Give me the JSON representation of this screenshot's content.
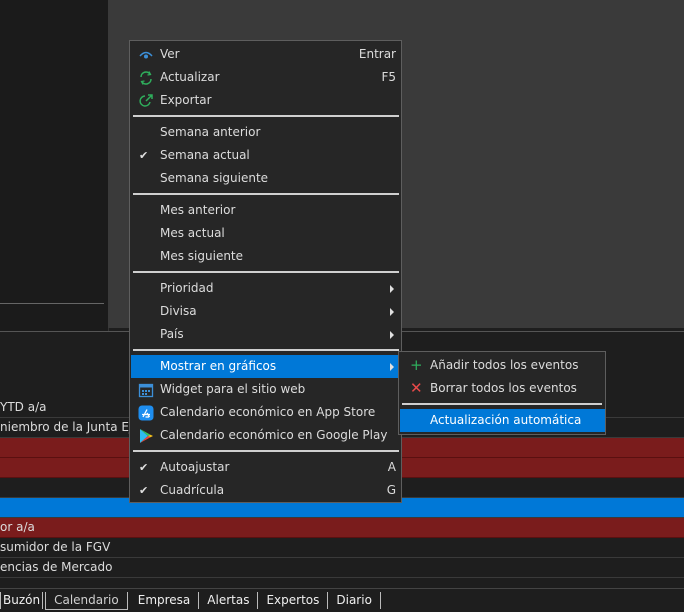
{
  "menu": {
    "view": {
      "label": "Ver",
      "shortcut": "Entrar"
    },
    "refresh": {
      "label": "Actualizar",
      "shortcut": "F5"
    },
    "export": {
      "label": "Exportar"
    },
    "prev_week": {
      "label": "Semana anterior"
    },
    "current_week": {
      "label": "Semana actual",
      "checked": true
    },
    "next_week": {
      "label": "Semana siguiente"
    },
    "prev_month": {
      "label": "Mes anterior"
    },
    "current_month": {
      "label": "Mes actual"
    },
    "next_month": {
      "label": "Mes siguiente"
    },
    "priority": {
      "label": "Prioridad"
    },
    "currency": {
      "label": "Divisa"
    },
    "country": {
      "label": "País"
    },
    "show_in_charts": {
      "label": "Mostrar en gráficos"
    },
    "widget": {
      "label": "Widget para el sitio web"
    },
    "app_store": {
      "label": "Calendario económico en App Store"
    },
    "google_play": {
      "label": "Calendario económico en Google Play"
    },
    "autofit": {
      "label": "Autoajustar",
      "shortcut": "A",
      "checked": true
    },
    "grid": {
      "label": "Cuadrícula",
      "shortcut": "G",
      "checked": true
    }
  },
  "submenu": {
    "add_all": {
      "label": "Añadir todos los eventos"
    },
    "remove_all": {
      "label": "Borrar todos los eventos"
    },
    "auto_update": {
      "label": "Actualización automática"
    }
  },
  "table_rows": [
    {
      "text": "YTD a/a",
      "style": "normal"
    },
    {
      "text": "niembro de la Junta Ejec",
      "style": "normal"
    },
    {
      "text": "",
      "style": "red"
    },
    {
      "text": "",
      "style": "red"
    },
    {
      "text": "",
      "style": "normal"
    },
    {
      "text": "",
      "style": "blue"
    },
    {
      "text": "or a/a",
      "style": "red"
    },
    {
      "text": "sumidor de la FGV",
      "style": "normal"
    },
    {
      "text": "encias de Mercado",
      "style": "normal"
    }
  ],
  "tabs": [
    "Buzón",
    "Calendario",
    "Empresa",
    "Alertas",
    "Expertos",
    "Diario"
  ],
  "active_tab": "Calendario",
  "colors": {
    "highlight": "#0078d7",
    "red_row": "#7a1c1c",
    "menu_bg": "#262626"
  },
  "icons": {
    "view": "eye-icon",
    "refresh": "refresh-icon",
    "export": "export-icon",
    "widget": "calendar-icon",
    "app_store": "app-store-icon",
    "google_play": "google-play-icon",
    "add_all": "plus-icon",
    "remove_all": "x-icon"
  }
}
